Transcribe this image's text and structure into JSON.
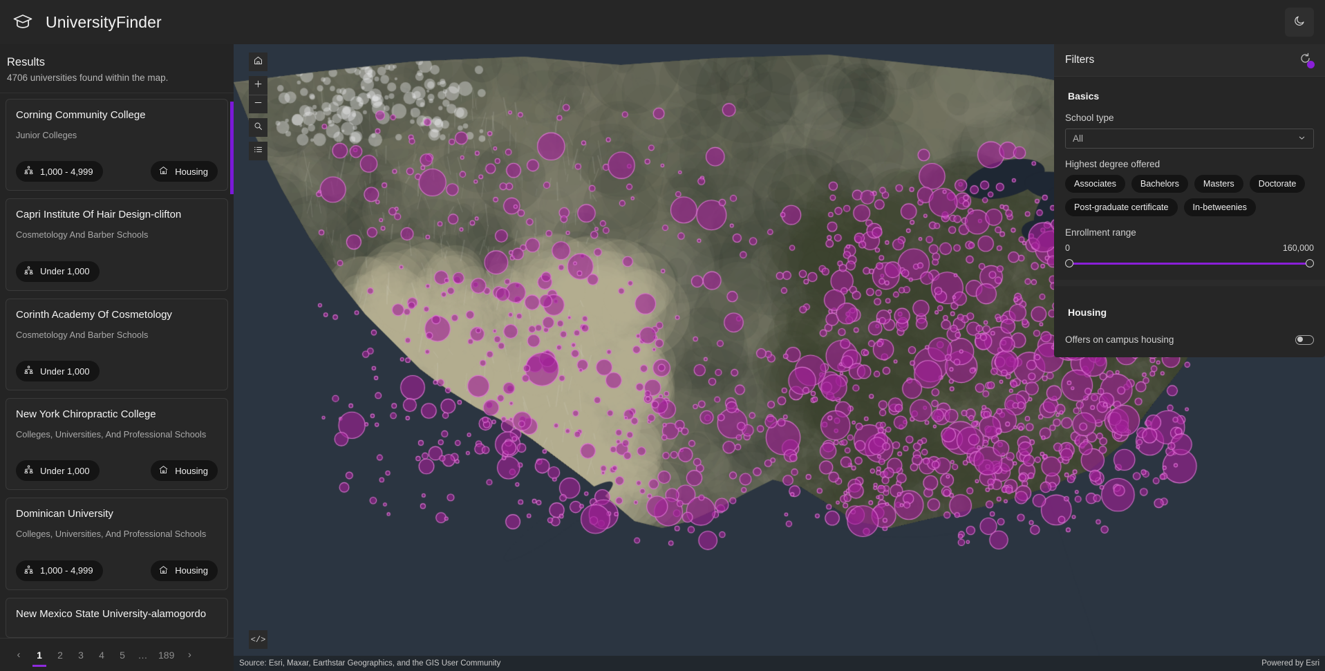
{
  "app": {
    "title": "UniversityFinder",
    "logo_icon": "graduation-cap-icon",
    "theme_toggle_icon": "moon-icon"
  },
  "results": {
    "heading": "Results",
    "subtitle": "4706 universities found within the map.",
    "enrollment_icon": "people-group-icon",
    "housing_icon": "house-icon",
    "cards": [
      {
        "name": "Corning Community College",
        "category": "Junior Colleges",
        "enrollment": "1,000 - 4,999",
        "housing": "Housing"
      },
      {
        "name": "Capri Institute Of Hair Design-clifton",
        "category": "Cosmetology And Barber Schools",
        "enrollment": "Under 1,000",
        "housing": ""
      },
      {
        "name": "Corinth Academy Of Cosmetology",
        "category": "Cosmetology And Barber Schools",
        "enrollment": "Under 1,000",
        "housing": ""
      },
      {
        "name": "New York Chiropractic College",
        "category": "Colleges, Universities, And Professional Schools",
        "enrollment": "Under 1,000",
        "housing": "Housing"
      },
      {
        "name": "Dominican University",
        "category": "Colleges, Universities, And Professional Schools",
        "enrollment": "1,000 - 4,999",
        "housing": "Housing"
      },
      {
        "name": "New Mexico State University-alamogordo",
        "category": "",
        "enrollment": "",
        "housing": ""
      }
    ]
  },
  "pagination": {
    "prev_icon": "chevron-left-icon",
    "next_icon": "chevron-right-icon",
    "pages": [
      "1",
      "2",
      "3",
      "4",
      "5",
      "…",
      "189"
    ],
    "current": "1"
  },
  "map": {
    "tools": [
      {
        "name": "home",
        "icon": "home-icon"
      },
      {
        "name": "zoom-in",
        "icon": "plus-icon"
      },
      {
        "name": "zoom-out",
        "icon": "minus-icon"
      },
      {
        "name": "search",
        "icon": "magnifier-icon"
      },
      {
        "name": "legend",
        "icon": "list-icon"
      }
    ],
    "code_button": "</>",
    "attribution": "Source: Esri, Maxar, Earthstar Geographics, and the GIS User Community",
    "powered_by": "Powered by Esri",
    "marker_color": "#b327a6"
  },
  "filters": {
    "title": "Filters",
    "reset_icon": "reset-icon",
    "basics": {
      "section_title": "Basics",
      "school_type_label": "School type",
      "school_type_value": "All",
      "dropdown_icon": "chevron-down-icon",
      "degree_label": "Highest degree offered",
      "degree_chips": [
        "Associates",
        "Bachelors",
        "Masters",
        "Doctorate",
        "Post-graduate certificate",
        "In-betweenies"
      ],
      "enrollment_label": "Enrollment range",
      "enrollment_min": "0",
      "enrollment_max": "160,000"
    },
    "housing": {
      "section_title": "Housing",
      "toggle_label": "Offers on campus housing",
      "toggle_on": false
    }
  },
  "colors": {
    "accent": "#8a1fd8",
    "panel": "#262626",
    "marker": "#b327a6"
  }
}
